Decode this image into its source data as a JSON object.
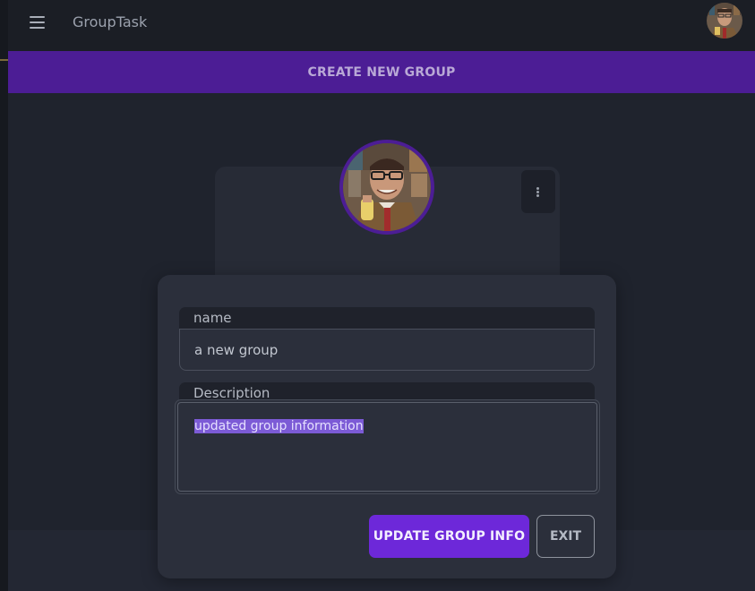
{
  "app": {
    "title": "GroupTask"
  },
  "banner": {
    "title": "CREATE NEW GROUP"
  },
  "group_card": {
    "menu_icon": "kebab-vertical-icon"
  },
  "form": {
    "name_label": "name",
    "name_value": "a new group",
    "description_label": "Description",
    "description_value": "updated group information",
    "update_button": "UPDATE GROUP INFO",
    "exit_button": "EXIT"
  },
  "colors": {
    "accent": "#6d28d9",
    "banner": "#4c1d95",
    "background": "#1f232d",
    "modal": "#2b2f3b",
    "selection": "#7c5bd6"
  }
}
